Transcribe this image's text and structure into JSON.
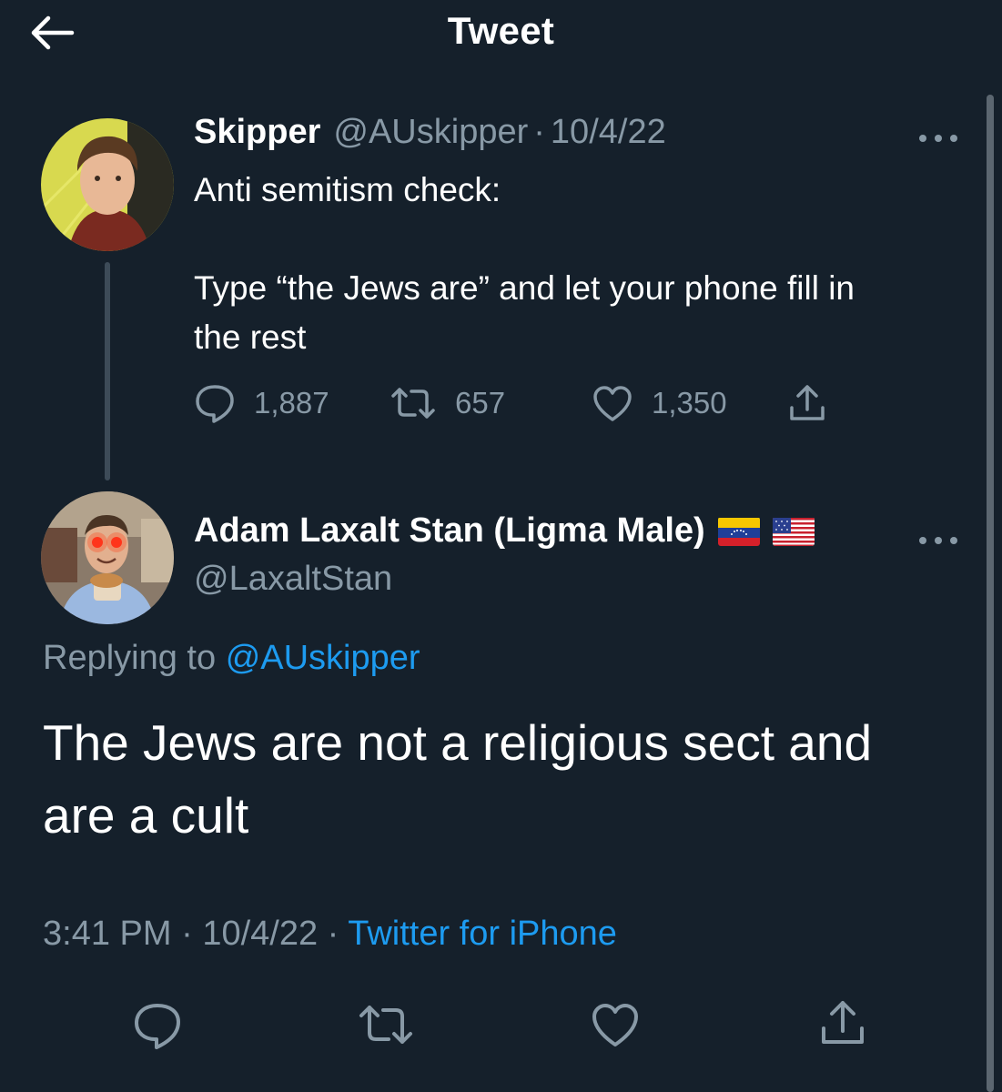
{
  "header": {
    "title": "Tweet",
    "back_icon": "arrow-left-icon"
  },
  "colors": {
    "background": "#15202b",
    "text_primary": "#ffffff",
    "text_secondary": "#8899a6",
    "link": "#1d9bf0"
  },
  "tweet1": {
    "name": "Skipper",
    "handle": "@AUskipper",
    "separator": "·",
    "date": "10/4/22",
    "text_lines": [
      "Anti semitism check:",
      "",
      "Type “the Jews are” and let your phone fill in",
      "the rest"
    ],
    "more_icon": "more-horizontal-icon",
    "stats": {
      "replies": "1,887",
      "retweets": "657",
      "likes": "1,350"
    }
  },
  "tweet2": {
    "name": "Adam Laxalt Stan (Ligma Male)",
    "flags": [
      "venezuela-flag-icon",
      "us-flag-icon"
    ],
    "handle": "@LaxaltStan",
    "replying_prefix": "Replying to",
    "replying_handle": "@AUskipper",
    "text_lines": [
      "The Jews are not a religious sect and",
      "are a cult"
    ],
    "time": "3:41 PM",
    "separator": "·",
    "date": "10/4/22",
    "source": "Twitter for iPhone",
    "more_icon": "more-horizontal-icon"
  }
}
